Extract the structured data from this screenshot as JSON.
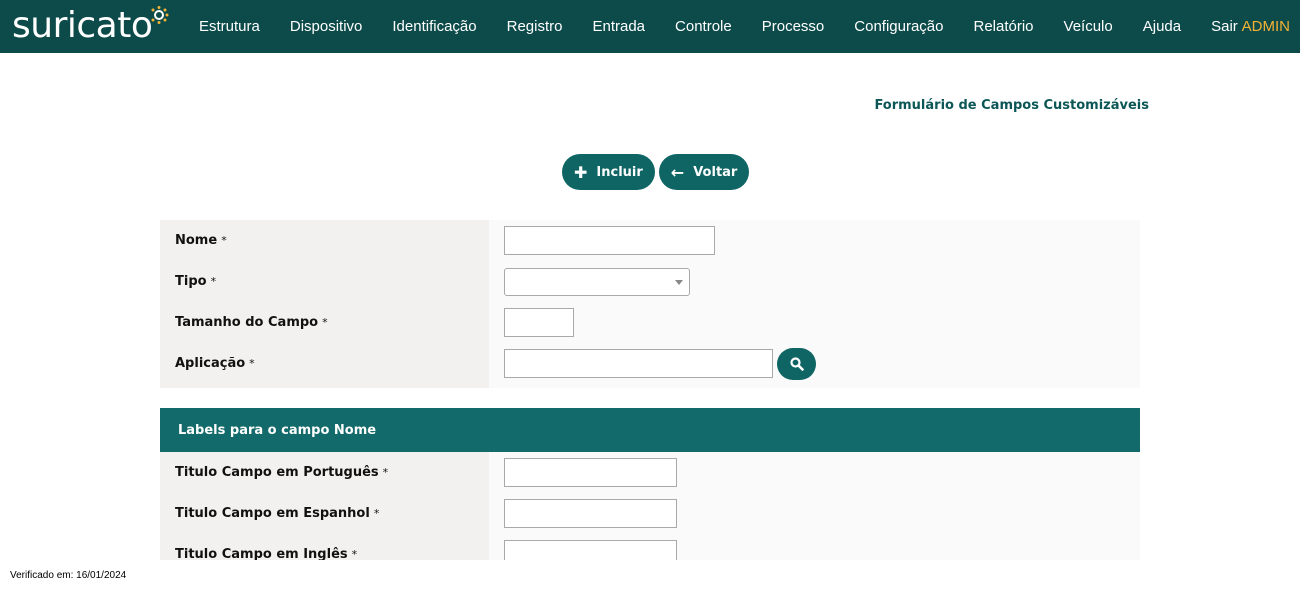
{
  "brand": {
    "name": "suricato"
  },
  "nav": {
    "items": [
      "Estrutura",
      "Dispositivo",
      "Identificação",
      "Registro",
      "Entrada",
      "Controle",
      "Processo",
      "Configuração",
      "Relatório",
      "Veículo",
      "Ajuda",
      "Sair"
    ],
    "user": "ADMIN"
  },
  "page": {
    "title": "Formulário de Campos Customizáveis"
  },
  "actions": {
    "include": "Incluir",
    "back": "Voltar"
  },
  "form": {
    "fields": [
      {
        "label": "Nome",
        "required": "*",
        "value": ""
      },
      {
        "label": "Tipo",
        "required": "*",
        "value": ""
      },
      {
        "label": "Tamanho do Campo",
        "required": "*",
        "value": ""
      },
      {
        "label": "Aplicação",
        "required": "*",
        "value": ""
      }
    ]
  },
  "labels_section": {
    "title": "Labels para o campo Nome",
    "fields": [
      {
        "label": "Titulo Campo em Português",
        "required": "*",
        "value": ""
      },
      {
        "label": "Titulo Campo em Espanhol",
        "required": "*",
        "value": ""
      },
      {
        "label": "Titulo Campo em Inglês",
        "required": "*",
        "value": ""
      }
    ]
  },
  "footer": {
    "verified": "Verificado em: 16/01/2024"
  },
  "colors": {
    "header_bg": "#0d4a4a",
    "accent": "#0f6464",
    "user": "#f2b233",
    "logo_dots": "#f2b233"
  }
}
